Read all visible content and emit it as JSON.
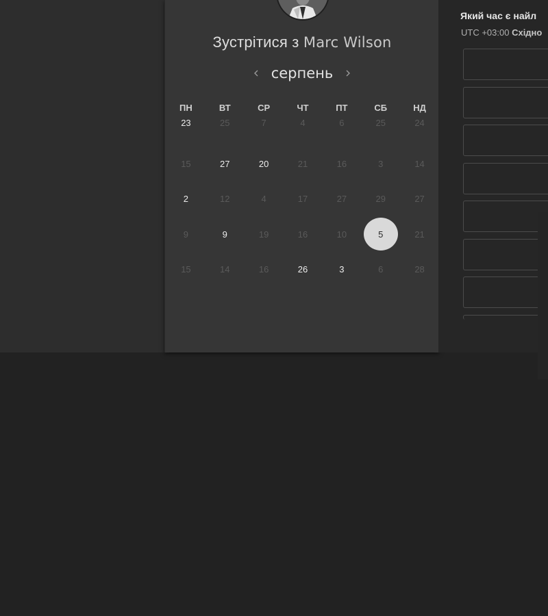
{
  "card": {
    "title_prefix": "Зустрітися з",
    "title_name": "Marc Wilson"
  },
  "calendar": {
    "month": "серпень",
    "prev_icon": "chevron-left-icon",
    "next_icon": "chevron-right-icon",
    "weekdays": [
      "ПН",
      "ВТ",
      "СР",
      "ЧТ",
      "ПТ",
      "СБ",
      "НД"
    ],
    "weeks": [
      [
        {
          "d": "23",
          "a": true
        },
        {
          "d": "25",
          "a": false
        },
        {
          "d": "7",
          "a": false
        },
        {
          "d": "4",
          "a": false
        },
        {
          "d": "6",
          "a": false
        },
        {
          "d": "25",
          "a": false
        },
        {
          "d": "24",
          "a": false
        }
      ],
      [
        {
          "d": "15",
          "a": false
        },
        {
          "d": "27",
          "a": true
        },
        {
          "d": "20",
          "a": true
        },
        {
          "d": "21",
          "a": false
        },
        {
          "d": "16",
          "a": false
        },
        {
          "d": "3",
          "a": false
        },
        {
          "d": "14",
          "a": false
        }
      ],
      [
        {
          "d": "2",
          "a": true
        },
        {
          "d": "12",
          "a": false
        },
        {
          "d": "4",
          "a": false
        },
        {
          "d": "17",
          "a": false
        },
        {
          "d": "27",
          "a": false
        },
        {
          "d": "29",
          "a": false
        },
        {
          "d": "27",
          "a": false
        }
      ],
      [
        {
          "d": "9",
          "a": false
        },
        {
          "d": "9",
          "a": true
        },
        {
          "d": "19",
          "a": false
        },
        {
          "d": "16",
          "a": false
        },
        {
          "d": "10",
          "a": false
        },
        {
          "d": "5",
          "a": true,
          "selected": true
        },
        {
          "d": "21",
          "a": false
        }
      ],
      [
        {
          "d": "15",
          "a": false
        },
        {
          "d": "14",
          "a": false
        },
        {
          "d": "16",
          "a": false
        },
        {
          "d": "26",
          "a": true
        },
        {
          "d": "3",
          "a": true
        },
        {
          "d": "6",
          "a": false
        },
        {
          "d": "28",
          "a": false
        }
      ]
    ]
  },
  "times": {
    "question": "Який час є найл",
    "tz_offset": "UTC +03:00",
    "tz_name": "Східно",
    "slot_count": 8
  },
  "colors": {
    "selected_day_bg": "#d9d9d9",
    "card_bg": "#363636",
    "page_bg": "#222222"
  }
}
